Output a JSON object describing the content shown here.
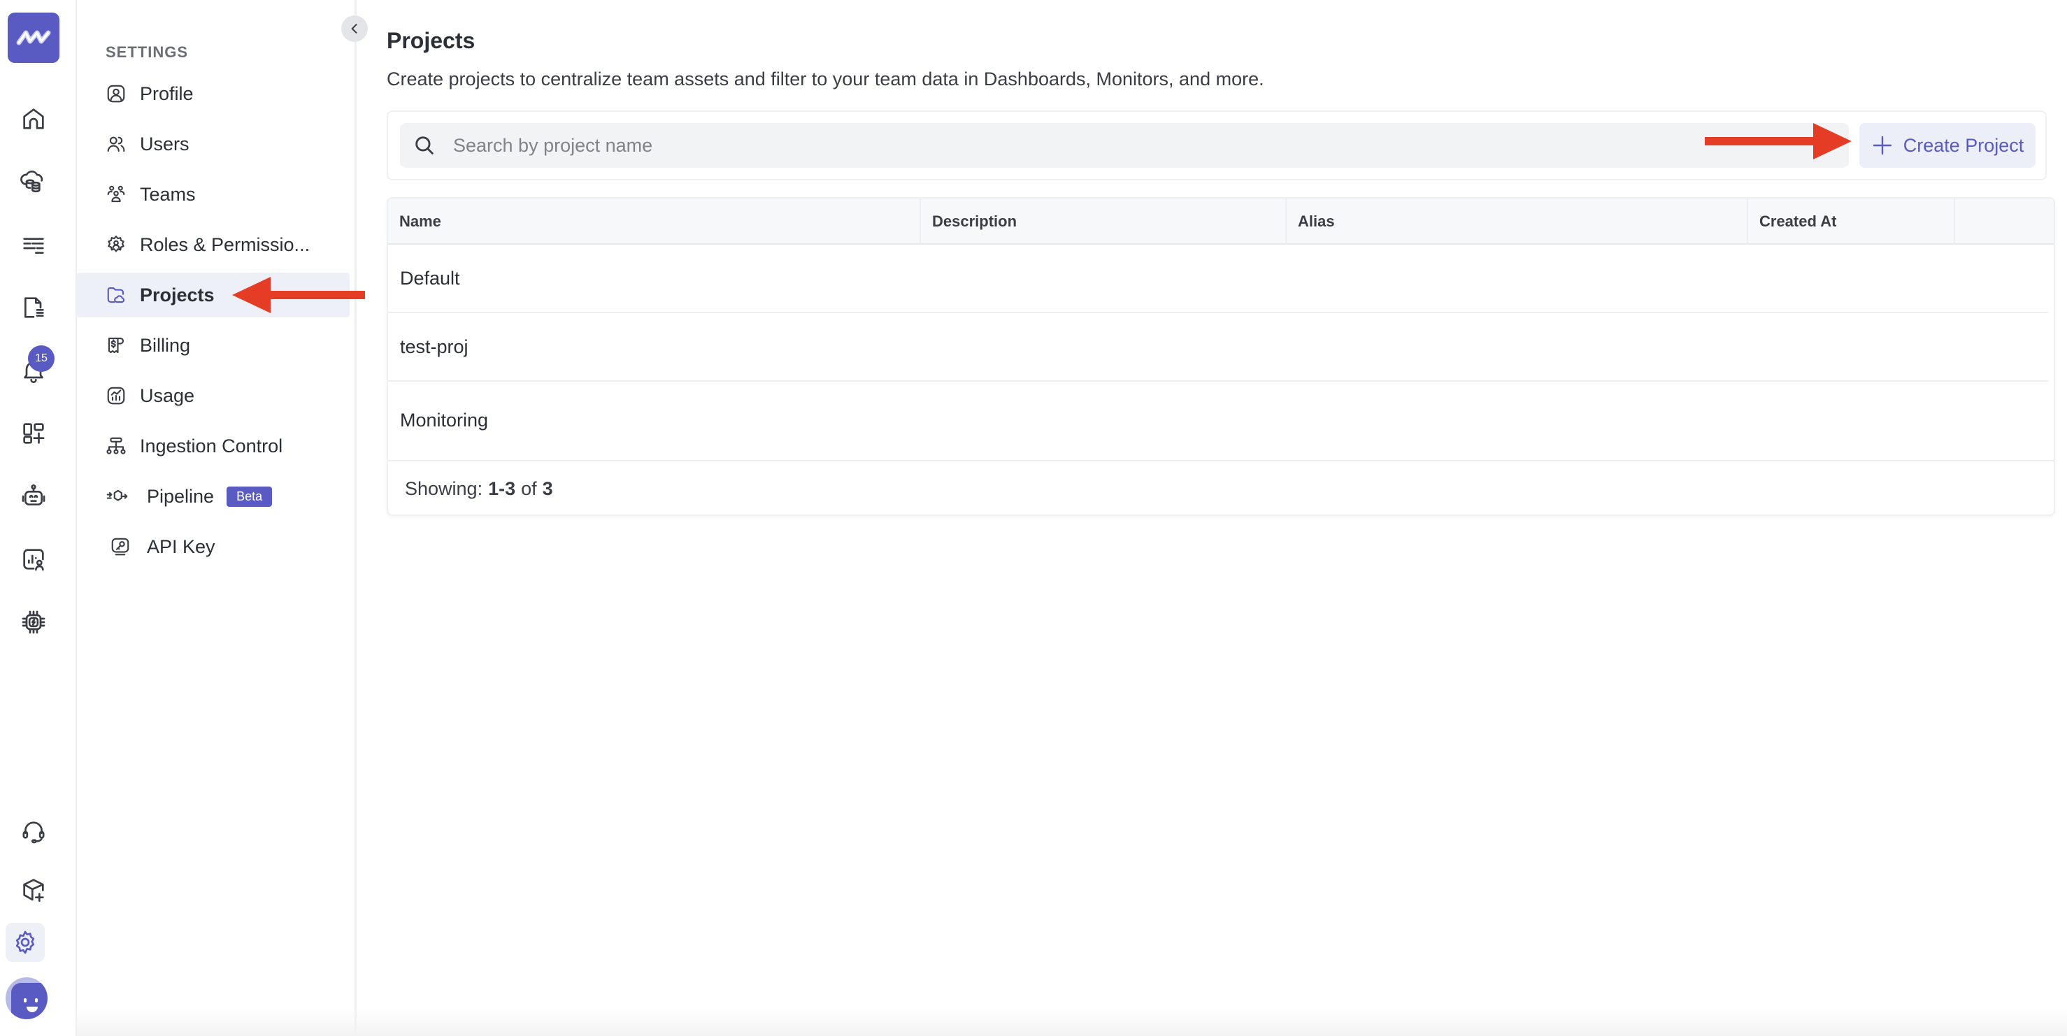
{
  "rail": {
    "logo": "middleware-logo",
    "items": [
      {
        "name": "home",
        "icon": "home-icon"
      },
      {
        "name": "infrastructure",
        "icon": "cloud-database-icon"
      },
      {
        "name": "logs",
        "icon": "logs-list-icon"
      },
      {
        "name": "reports",
        "icon": "document-icon"
      },
      {
        "name": "alerts",
        "icon": "bell-icon",
        "badge": "15"
      },
      {
        "name": "dashboard-builder",
        "icon": "dashboard-add-icon"
      },
      {
        "name": "ai-assistant",
        "icon": "robot-icon"
      },
      {
        "name": "rum",
        "icon": "user-analytics-icon"
      },
      {
        "name": "llm-observability",
        "icon": "chip-icon"
      },
      {
        "name": "support",
        "icon": "headset-icon"
      },
      {
        "name": "installation",
        "icon": "box-add-icon"
      },
      {
        "name": "settings",
        "icon": "gear-icon",
        "active": true
      }
    ],
    "accent": "#5a5bc2"
  },
  "sidebar": {
    "heading": "SETTINGS",
    "items": [
      {
        "label": "Profile",
        "icon": "profile-icon"
      },
      {
        "label": "Users",
        "icon": "users-icon"
      },
      {
        "label": "Teams",
        "icon": "teams-icon"
      },
      {
        "label": "Roles & Permissio...",
        "icon": "roles-icon"
      },
      {
        "label": "Projects",
        "icon": "folder-cloud-icon",
        "active": true
      },
      {
        "label": "Billing",
        "icon": "billing-icon"
      },
      {
        "label": "Usage",
        "icon": "usage-chart-icon"
      },
      {
        "label": "Ingestion Control",
        "icon": "ingestion-icon"
      },
      {
        "label": "Pipeline",
        "icon": "pipeline-icon",
        "badge": "Beta"
      },
      {
        "label": "API Key",
        "icon": "api-key-icon"
      }
    ]
  },
  "main": {
    "title": "Projects",
    "subtitle": "Create projects to centralize team assets and filter to your team data in Dashboards, Monitors, and more.",
    "search": {
      "placeholder": "Search by project name",
      "value": ""
    },
    "create_button": "Create Project",
    "table": {
      "columns": [
        "Name",
        "Description",
        "Alias",
        "Created At"
      ],
      "rows": [
        {
          "name": "Default",
          "description": "",
          "alias": "",
          "created_at": ""
        },
        {
          "name": "test-proj",
          "description": "",
          "alias": "",
          "created_at": ""
        },
        {
          "name": "Monitoring",
          "description": "",
          "alias": "",
          "created_at": ""
        }
      ],
      "footer": {
        "prefix": "Showing:",
        "range": "1-3",
        "of": "of",
        "total": "3"
      }
    }
  },
  "annotations": {
    "arrow_color": "#e53d25"
  }
}
